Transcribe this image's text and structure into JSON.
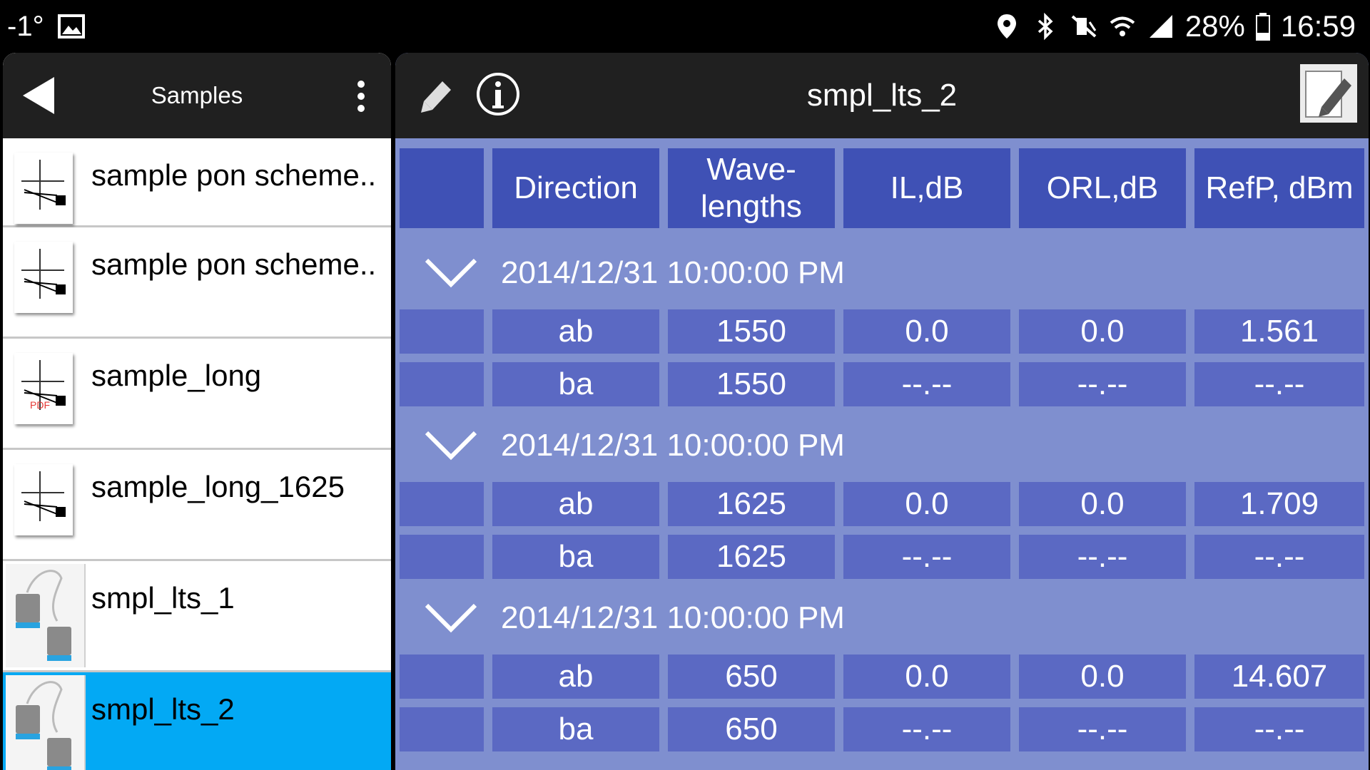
{
  "status_bar": {
    "temperature": "-1°",
    "battery": "28%",
    "time": "16:59",
    "icons": [
      "image-icon",
      "location-icon",
      "bluetooth-icon",
      "mute-icon",
      "wifi-icon",
      "signal-icon",
      "battery-icon"
    ]
  },
  "left_panel": {
    "title": "Samples",
    "items": [
      {
        "label": "sample pon scheme..",
        "icon": "scheme-icon"
      },
      {
        "label": "sample pon scheme..",
        "icon": "scheme-icon"
      },
      {
        "label": "sample_long",
        "icon": "scheme-pdf-icon",
        "pdf_badge": "PDF"
      },
      {
        "label": "sample_long_1625",
        "icon": "scheme-icon"
      },
      {
        "label": "smpl_lts_1",
        "icon": "lts-device-icon"
      },
      {
        "label": "smpl_lts_2",
        "icon": "lts-device-icon",
        "selected": true
      }
    ]
  },
  "right_panel": {
    "title": "smpl_lts_2",
    "columns": [
      "",
      "Direction",
      "Wave-\nlengths",
      "IL,dB",
      "ORL,dB",
      "RefP, dBm"
    ],
    "groups": [
      {
        "date": "2014/12/31 10:00:00 PM",
        "rows": [
          {
            "direction": "ab",
            "wavelength": "1550",
            "il": "0.0",
            "orl": "0.0",
            "refp": "1.561"
          },
          {
            "direction": "ba",
            "wavelength": "1550",
            "il": "--.--",
            "orl": "--.--",
            "refp": "--.--"
          }
        ]
      },
      {
        "date": "2014/12/31 10:00:00 PM",
        "rows": [
          {
            "direction": "ab",
            "wavelength": "1625",
            "il": "0.0",
            "orl": "0.0",
            "refp": "1.709"
          },
          {
            "direction": "ba",
            "wavelength": "1625",
            "il": "--.--",
            "orl": "--.--",
            "refp": "--.--"
          }
        ]
      },
      {
        "date": "2014/12/31 10:00:00 PM",
        "rows": [
          {
            "direction": "ab",
            "wavelength": "650",
            "il": "0.0",
            "orl": "0.0",
            "refp": "14.607"
          },
          {
            "direction": "ba",
            "wavelength": "650",
            "il": "--.--",
            "orl": "--.--",
            "refp": "--.--"
          }
        ]
      }
    ]
  },
  "colors": {
    "header_bg": "#202020",
    "selected_bg": "#03a9f4",
    "table_bg": "#7f8fcf",
    "header_cell": "#3f51b5",
    "data_cell": "#5b69c3"
  }
}
